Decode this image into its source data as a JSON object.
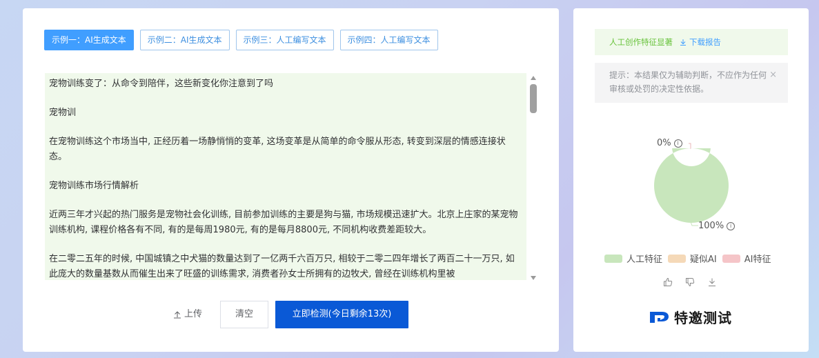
{
  "tabs": [
    {
      "label": "示例一：AI生成文本"
    },
    {
      "label": "示例二：AI生成文本"
    },
    {
      "label": "示例三：人工编写文本"
    },
    {
      "label": "示例四：人工编写文本"
    }
  ],
  "content": {
    "paragraphs": [
      "宠物训练变了：从命令到陪伴，这些新变化你注意到了吗",
      "宠物训",
      "在宠物训练这个市场当中, 正经历着一场静悄悄的变革, 这场变革是从简单的命令服从形态, 转变到深层的情感连接状态。",
      "宠物训练市场行情解析",
      "近两三年才兴起的热门服务是宠物社会化训练, 目前参加训练的主要是狗与猫, 市场规模迅速扩大。北京上庄家的某宠物训练机构, 课程价格各有不同, 有的是每周1980元, 有的是每月8800元, 不同机构收费差距较大。",
      "在二零二五年的时候, 中国城镇之中犬猫的数量达到了一亿两千六百万只, 相较于二零二四年增长了两百二十一万只, 如此庞大的数量基数从而催生出来了旺盛的训练需求, 消费者孙女士所拥有的边牧犬, 曾经在训练机构里被"
    ]
  },
  "buttons": {
    "upload": "上传",
    "clear": "清空",
    "detect": "立即检测(今日剩余13次)"
  },
  "result": {
    "status": "人工创作特征显著",
    "download": "下载报告",
    "hint": "提示：本结果仅为辅助判断，不应作为任何审核或处罚的决定性依据。",
    "close": "×"
  },
  "chart_data": {
    "type": "pie",
    "labels": [
      "人工特征",
      "疑似AI",
      "AI特征"
    ],
    "values": [
      100,
      0,
      0
    ],
    "colors": [
      "#c8e6bc",
      "#f5d9b8",
      "#f5c5c8"
    ],
    "top_label": "0%",
    "bottom_label": "100%"
  },
  "legend": [
    {
      "label": "人工特征",
      "color": "#c8e6bc"
    },
    {
      "label": "疑似AI",
      "color": "#f5d9b8"
    },
    {
      "label": "AI特征",
      "color": "#f5c5c8"
    }
  ],
  "info_glyph": "i",
  "brand": {
    "name": "特邀测试"
  }
}
